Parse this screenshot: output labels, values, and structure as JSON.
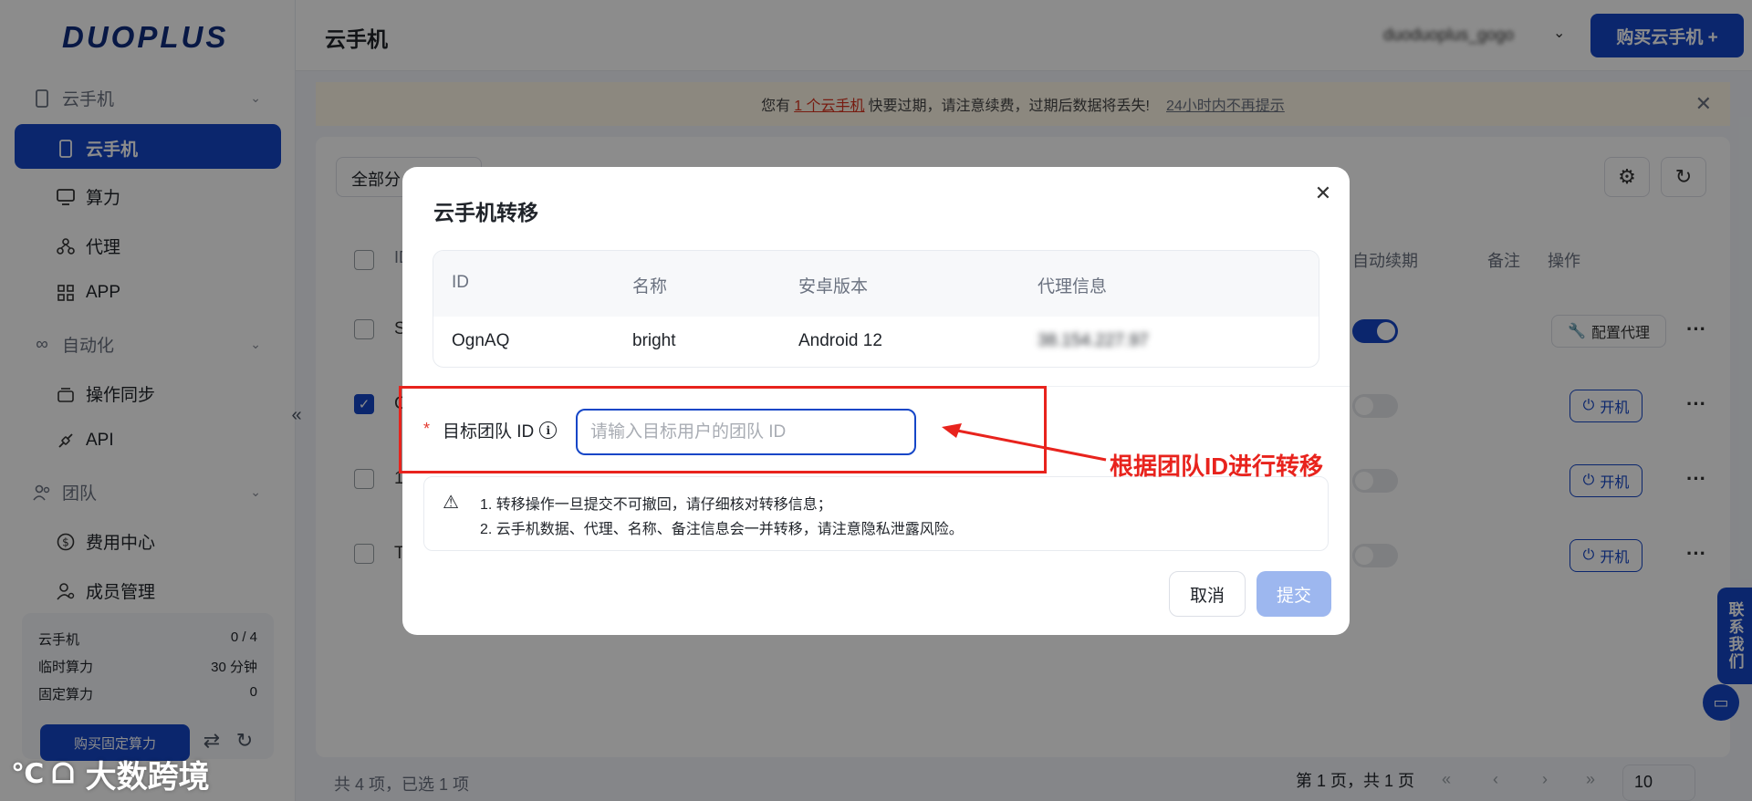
{
  "brand": {
    "logo": "DUOPLUS",
    "accent": "#1546c7",
    "annotation_color": "#e8231d"
  },
  "sidebar": {
    "groups": [
      {
        "label": "云手机",
        "icon": "phone-outline-icon"
      },
      {
        "label": "自动化",
        "icon": "infinity-icon"
      },
      {
        "label": "团队",
        "icon": "team-icon"
      }
    ],
    "items": [
      {
        "label": "云手机",
        "icon": "phone-icon",
        "active": true
      },
      {
        "label": "算力",
        "icon": "monitor-icon"
      },
      {
        "label": "代理",
        "icon": "proxy-network-icon"
      },
      {
        "label": "APP",
        "icon": "grid-icon"
      },
      {
        "label": "操作同步",
        "icon": "sync-stack-icon"
      },
      {
        "label": "API",
        "icon": "api-plug-icon"
      },
      {
        "label": "费用中心",
        "icon": "dollar-icon"
      },
      {
        "label": "成员管理",
        "icon": "user-settings-icon"
      }
    ],
    "stats": [
      {
        "label": "云手机",
        "value": "0 / 4"
      },
      {
        "label": "临时算力",
        "value": "30 分钟"
      },
      {
        "label": "固定算力",
        "value": "0"
      }
    ],
    "buy_fixed_label": "购买固定算力"
  },
  "header": {
    "title": "云手机",
    "user_name": "duoduoplus_gogo",
    "buy_label": "购买云手机 +"
  },
  "notice": {
    "prefix": "您有",
    "count_text": "1 个云手机",
    "suffix": "快要过期，请注意续费，过期后数据将丢失!",
    "dismiss": "24小时内不再提示"
  },
  "table": {
    "filter_label": "全部分",
    "headers": {
      "id": "ID",
      "auto_renew": "自动续期",
      "remark": "备注",
      "action": "操作"
    },
    "rows": [
      {
        "first": "S",
        "checked": false,
        "renew": true,
        "action": "配置代理"
      },
      {
        "first": "C",
        "checked": true,
        "renew": false,
        "action": "开机"
      },
      {
        "first": "1",
        "checked": false,
        "renew": false,
        "action": "开机"
      },
      {
        "first": "T",
        "checked": false,
        "renew": false,
        "action": "开机"
      }
    ],
    "footer_count": "共 4 项，已选 1 项",
    "pager_text": "第 1 页，共 1 页",
    "page_size": "10"
  },
  "contact_label": "联系我们",
  "modal": {
    "title": "云手机转移",
    "columns": [
      "ID",
      "名称",
      "安卓版本",
      "代理信息"
    ],
    "row": {
      "id": "OgnAQ",
      "name": "bright",
      "android": "Android 12",
      "proxy": "38.154.227.97"
    },
    "field_label": "目标团队 ID",
    "placeholder": "请输入目标用户的团队 ID",
    "warnings": [
      "1. 转移操作一旦提交不可撤回，请仔细核对转移信息；",
      "2. 云手机数据、代理、名称、备注信息会一并转移，请注意隐私泄露风险。"
    ],
    "cancel_label": "取消",
    "submit_label": "提交"
  },
  "annotation": {
    "text": "根据团队ID进行转移"
  },
  "watermark": {
    "logo": "℃ ⁠ᗝ",
    "text": "大数跨境"
  }
}
